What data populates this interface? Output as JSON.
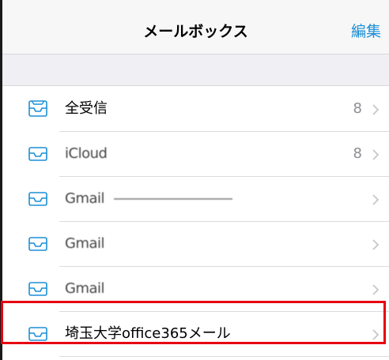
{
  "navbar": {
    "title": "メールボックス",
    "edit_label": "編集"
  },
  "mailboxes": [
    {
      "label": "全受信",
      "count": "8",
      "icon": "inbox-icon"
    },
    {
      "label": "iCloud",
      "count": "8",
      "icon": "inbox-icon"
    },
    {
      "label": "Gmail",
      "count": "",
      "icon": "inbox-icon"
    },
    {
      "label": "Gmail",
      "count": "",
      "icon": "inbox-icon"
    },
    {
      "label": "Gmail",
      "count": "",
      "icon": "inbox-icon"
    },
    {
      "label": "埼玉大学office365メール",
      "count": "",
      "icon": "inbox-icon"
    }
  ],
  "colors": {
    "accent": "#1b8fd6",
    "highlight": "#e60012",
    "navbar_bg": "#f7f7f7",
    "group_bg": "#efeff4",
    "chevron": "#c7c7cc"
  }
}
